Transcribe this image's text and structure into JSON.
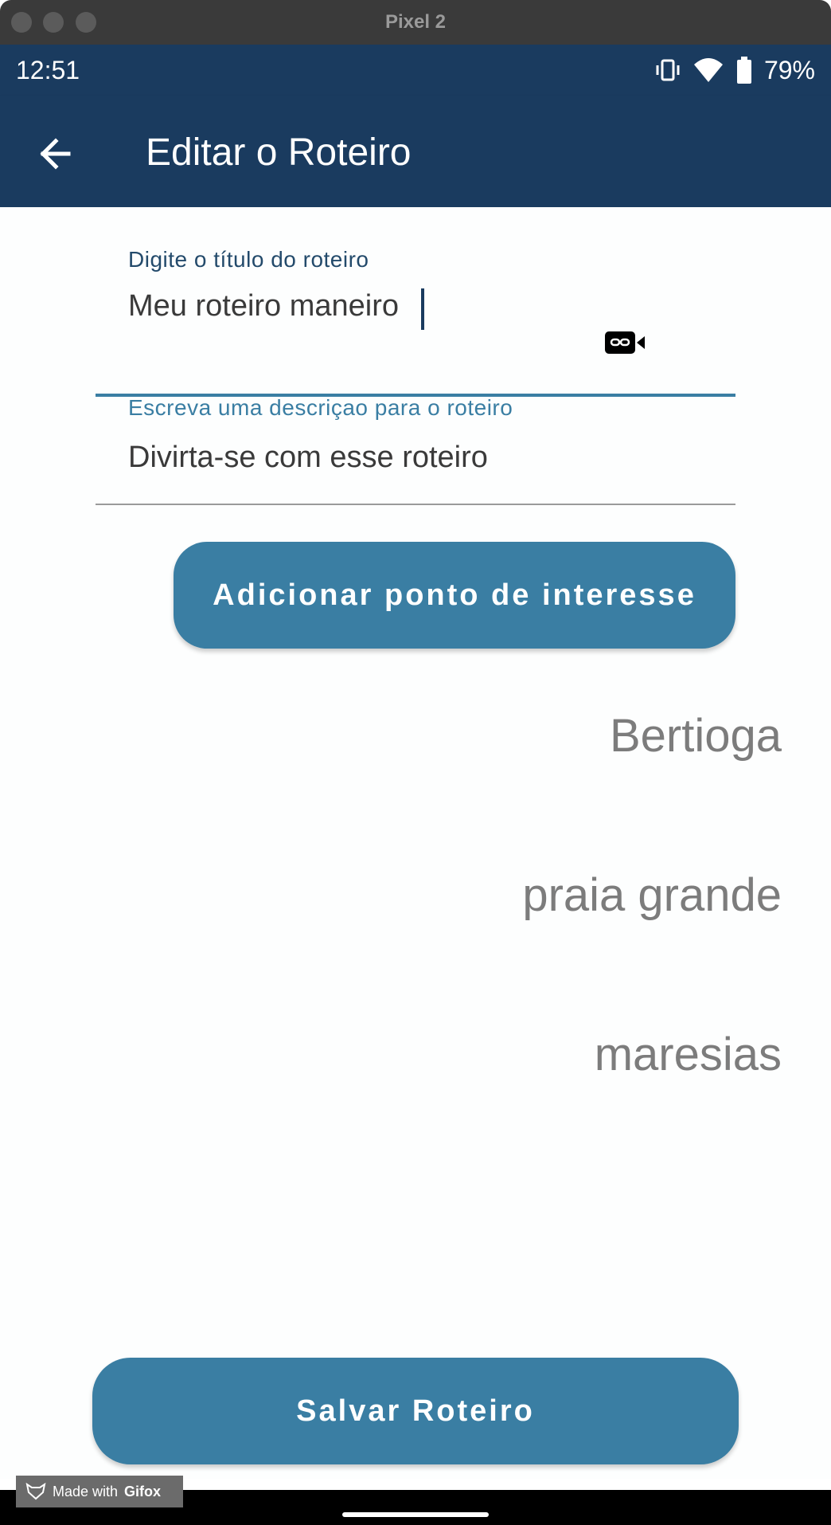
{
  "window": {
    "title": "Pixel 2"
  },
  "status_bar": {
    "time": "12:51",
    "battery": "79%",
    "icons": [
      "vibrate-icon",
      "wifi-icon",
      "battery-icon"
    ]
  },
  "app_bar": {
    "title": "Editar o Roteiro",
    "back_icon": "arrow-left-icon"
  },
  "form": {
    "title_field": {
      "label": "Digite o título do roteiro",
      "value": "Meu roteiro maneiro"
    },
    "description_field": {
      "label": "Escreva uma descriçao para o roteiro",
      "value": "Divirta-se com esse roteiro"
    }
  },
  "add_poi_button": {
    "label": "Adicionar ponto de interesse"
  },
  "points_of_interest": [
    "Bertioga",
    "praia grande",
    "maresias"
  ],
  "save_button": {
    "label": "Salvar Roteiro"
  },
  "badge": {
    "prefix": "Made with",
    "brand": "Gifox"
  },
  "colors": {
    "primary_dark": "#1a3b5f",
    "primary": "#3a7ea3",
    "text_gray": "#7c7c7c"
  }
}
